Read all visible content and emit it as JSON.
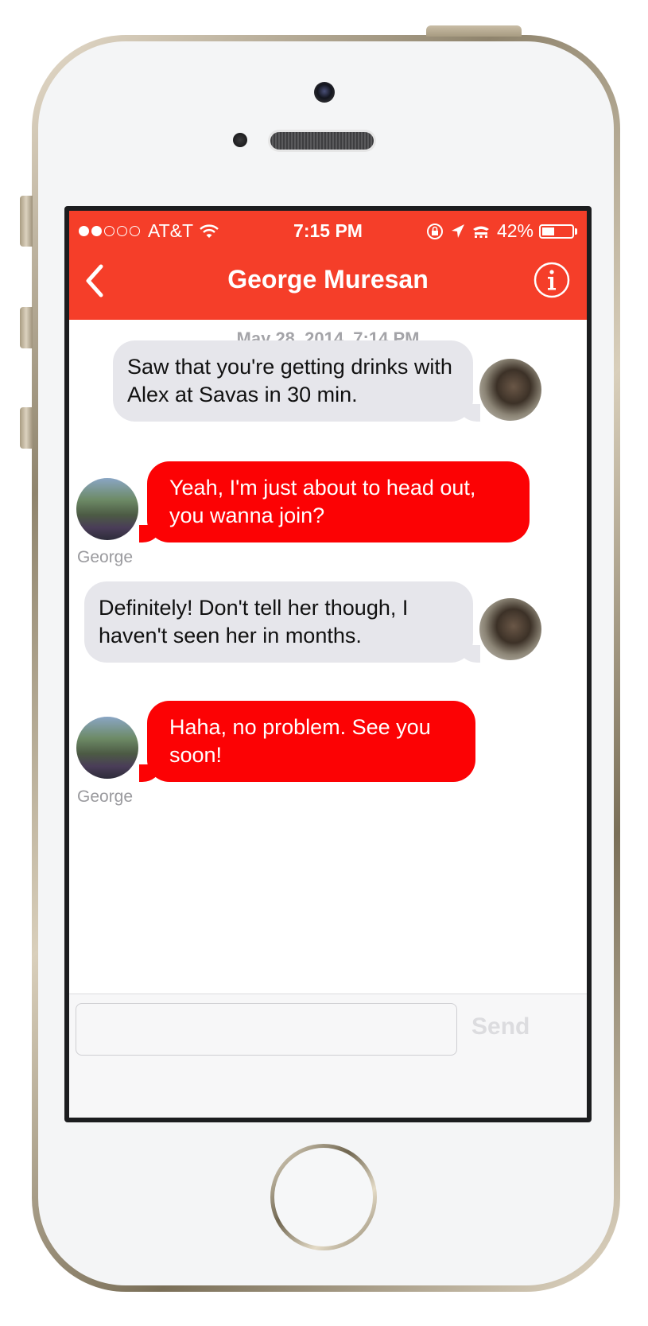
{
  "status_bar": {
    "carrier": "AT&T",
    "time": "7:15 PM",
    "battery_percent": "42%",
    "battery_level": 0.42,
    "signal_bars_filled": 2,
    "signal_bars_total": 5
  },
  "header": {
    "title": "George Muresan",
    "back_icon": "chevron-left-icon",
    "info_icon": "info-circle-icon",
    "color": "#f53e29"
  },
  "conversation": {
    "timestamp": "May 28, 2014, 7:14 PM",
    "messages": [
      {
        "direction": "incoming",
        "text": "Saw that you're getting drinks with Alex at Savas in 30 min."
      },
      {
        "direction": "outgoing",
        "text": "Yeah, I'm just about to head out, you wanna join?",
        "sender": "George"
      },
      {
        "direction": "incoming",
        "text": "Definitely! Don't tell her though, I haven't seen her in months."
      },
      {
        "direction": "outgoing",
        "text": "Haha, no problem. See you soon!",
        "sender": "George"
      }
    ]
  },
  "composer": {
    "placeholder": "",
    "send_label": "Send"
  },
  "colors": {
    "incoming_bubble": "#e6e6eb",
    "outgoing_bubble": "#fc0204"
  }
}
